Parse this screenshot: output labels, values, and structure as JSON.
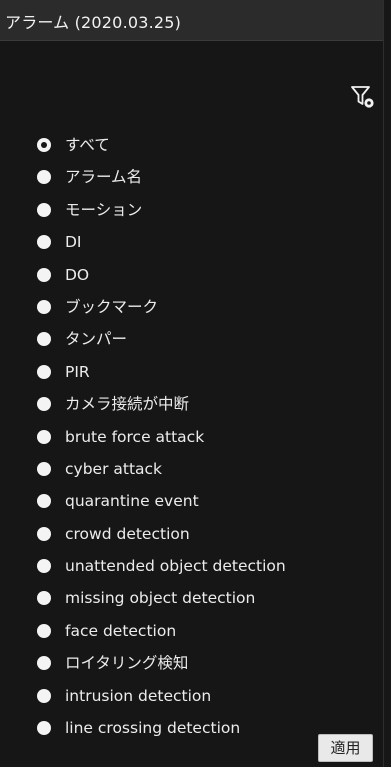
{
  "header": {
    "title": "アラーム (2020.03.25)"
  },
  "toolbar": {
    "filter_icon": "filter-settings-icon"
  },
  "alarm_types": [
    {
      "label": "すべて",
      "checked": true
    },
    {
      "label": "アラーム名",
      "checked": false
    },
    {
      "label": "モーション",
      "checked": false
    },
    {
      "label": "DI",
      "checked": false
    },
    {
      "label": "DO",
      "checked": false
    },
    {
      "label": "ブックマーク",
      "checked": false
    },
    {
      "label": "タンパー",
      "checked": false
    },
    {
      "label": "PIR",
      "checked": false
    },
    {
      "label": "カメラ接続が中断",
      "checked": false
    },
    {
      "label": "brute force attack",
      "checked": false
    },
    {
      "label": "cyber attack",
      "checked": false
    },
    {
      "label": "quarantine event",
      "checked": false
    },
    {
      "label": "crowd detection",
      "checked": false
    },
    {
      "label": "unattended object detection",
      "checked": false
    },
    {
      "label": "missing object detection",
      "checked": false
    },
    {
      "label": "face detection",
      "checked": false
    },
    {
      "label": "ロイタリング検知",
      "checked": false
    },
    {
      "label": "intrusion detection",
      "checked": false
    },
    {
      "label": "line crossing detection",
      "checked": false
    }
  ],
  "footer": {
    "apply_label": "適用"
  },
  "colors": {
    "background": "#161616",
    "titlebar": "#2b2b2b",
    "text": "#ececec",
    "button": "#e9e9e9"
  }
}
